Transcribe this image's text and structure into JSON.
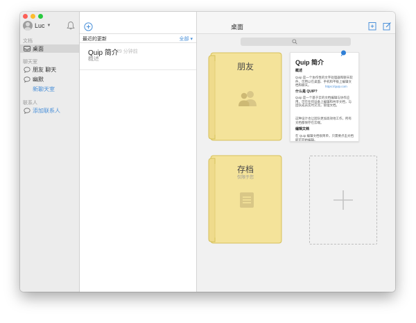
{
  "sidebar": {
    "user_name": "Luc",
    "sections": {
      "docs_label": "文档",
      "chats_label": "聊天室",
      "contacts_label": "联系人"
    },
    "items": [
      {
        "label": "桌面"
      },
      {
        "label": "朋友 聊天"
      },
      {
        "label": "幽默"
      }
    ],
    "new_chat_label": "新聊天室",
    "add_contact_label": "添加联系人"
  },
  "list": {
    "header_title": "最近的更新",
    "filter_label": "全部",
    "docs": [
      {
        "title": "Quip 简介",
        "time": "29 分钟前",
        "subtitle": "概述"
      }
    ]
  },
  "desktop": {
    "title": "桌面",
    "folders": [
      {
        "name": "朋友",
        "subtitle": "",
        "icon": "people-icon"
      },
      {
        "name": "存档",
        "subtitle": "仅限于您",
        "icon": "archive-box-icon"
      }
    ],
    "doc_card": {
      "title": "Quip 简介",
      "heading1": "概述",
      "para1": "Quip 是一个协作性的文字处理器和聊天软件，可用以在桌面、手机和平板上编辑文档和聊天。",
      "link": "https://quip.com",
      "heading2": "什么是 QUIP?",
      "para2": "Quip 是一个基于云的文档编辑与协作应用，可在任何设备上编辑和共享文档，与团队成员实时交流，管理文档。",
      "para3": "这种设计也让团队更加高效地工作，所有文档都保存在云端。",
      "heading3": "编辑文档",
      "para4": "在 Quip 编辑文档很简单，只需要点击文档即可开始编辑。"
    }
  },
  "colors": {
    "accent": "#4a90d9",
    "folder_fill": "#f7e8a1",
    "folder_stroke": "#d8c35f"
  }
}
